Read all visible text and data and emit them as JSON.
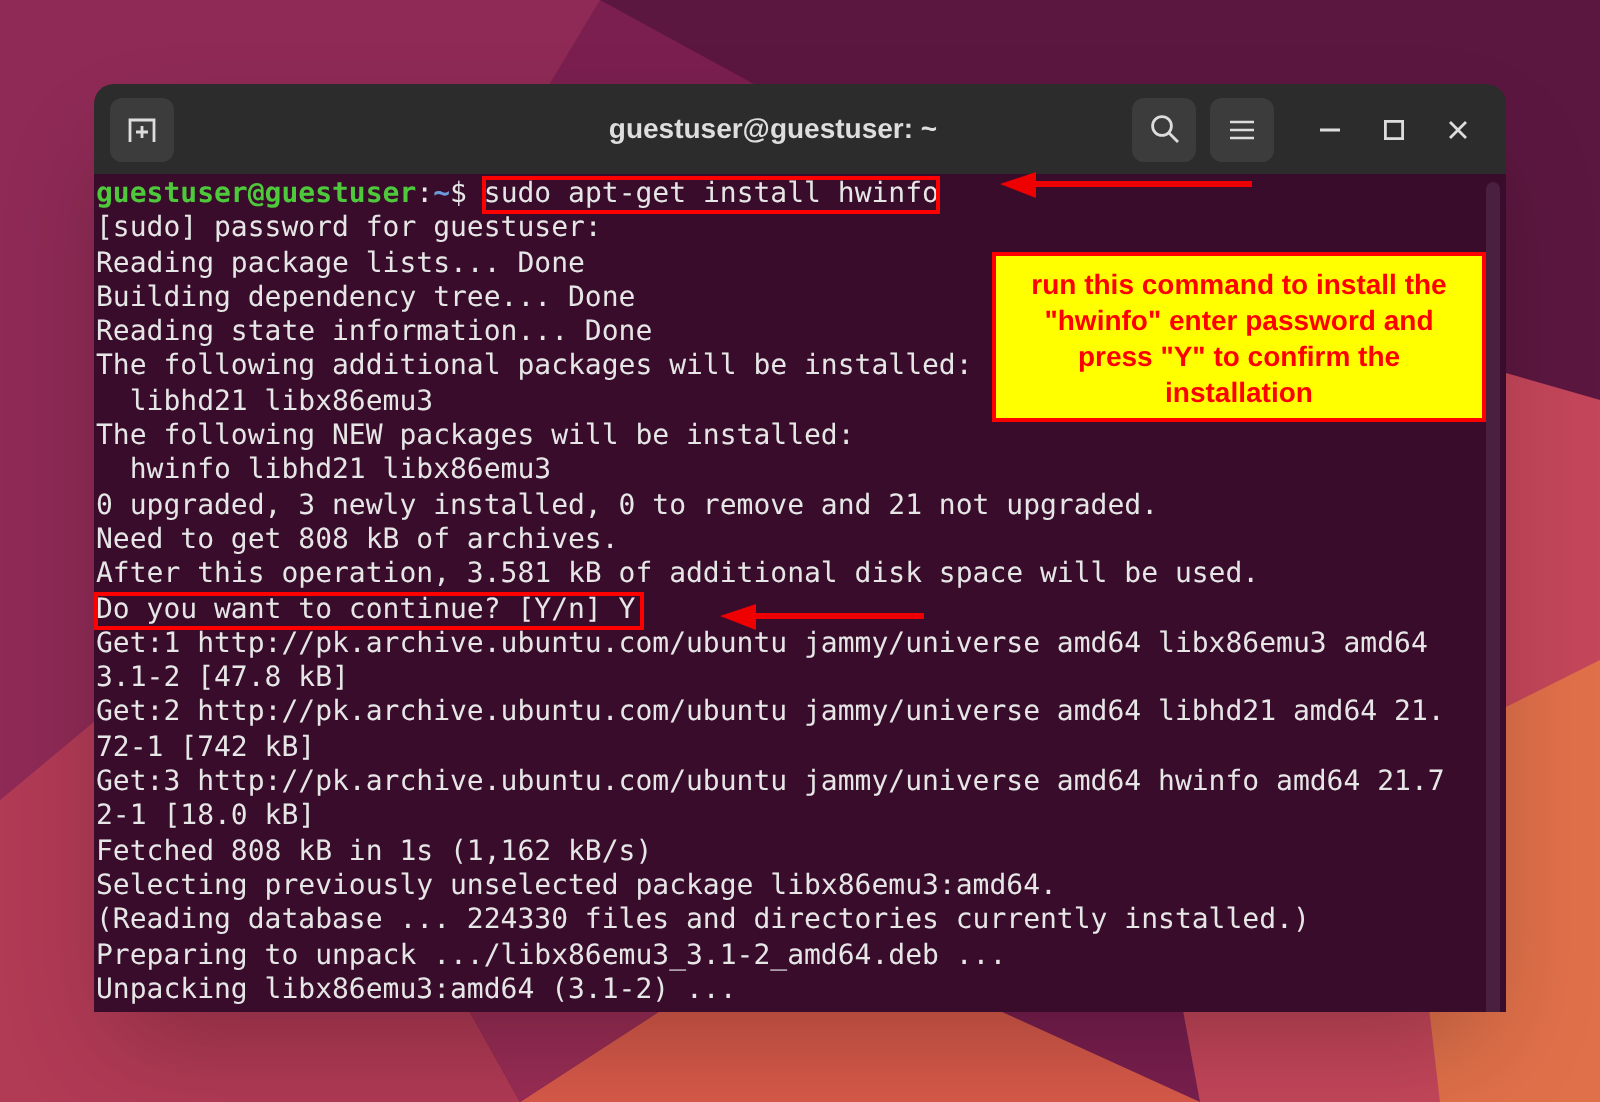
{
  "window": {
    "title": "guestuser@guestuser: ~"
  },
  "terminal": {
    "lines": [
      {
        "kind": "prompt",
        "user": "guestuser@guestuser",
        "separator": ":",
        "path": "~",
        "symbol": "$",
        "command": "sudo apt-get install hwinfo",
        "highlighted": true
      },
      {
        "kind": "output",
        "text": "[sudo] password for guestuser:",
        "highlighted": false
      },
      {
        "kind": "output",
        "text": "Reading package lists... Done",
        "highlighted": false
      },
      {
        "kind": "output",
        "text": "Building dependency tree... Done",
        "highlighted": false
      },
      {
        "kind": "output",
        "text": "Reading state information... Done",
        "highlighted": false
      },
      {
        "kind": "output",
        "text": "The following additional packages will be installed:",
        "highlighted": false
      },
      {
        "kind": "output",
        "text": "  libhd21 libx86emu3",
        "highlighted": false
      },
      {
        "kind": "output",
        "text": "The following NEW packages will be installed:",
        "highlighted": false
      },
      {
        "kind": "output",
        "text": "  hwinfo libhd21 libx86emu3",
        "highlighted": false
      },
      {
        "kind": "output",
        "text": "0 upgraded, 3 newly installed, 0 to remove and 21 not upgraded.",
        "highlighted": false
      },
      {
        "kind": "output",
        "text": "Need to get 808 kB of archives.",
        "highlighted": false
      },
      {
        "kind": "output",
        "text": "After this operation, 3.581 kB of additional disk space will be used.",
        "highlighted": false
      },
      {
        "kind": "output",
        "text": "Do you want to continue? [Y/n] Y",
        "highlighted": true
      },
      {
        "kind": "output",
        "text": "Get:1 http://pk.archive.ubuntu.com/ubuntu jammy/universe amd64 libx86emu3 amd64",
        "highlighted": false
      },
      {
        "kind": "output",
        "text": "3.1-2 [47.8 kB]",
        "highlighted": false
      },
      {
        "kind": "output",
        "text": "Get:2 http://pk.archive.ubuntu.com/ubuntu jammy/universe amd64 libhd21 amd64 21.",
        "highlighted": false
      },
      {
        "kind": "output",
        "text": "72-1 [742 kB]",
        "highlighted": false
      },
      {
        "kind": "output",
        "text": "Get:3 http://pk.archive.ubuntu.com/ubuntu jammy/universe amd64 hwinfo amd64 21.7",
        "highlighted": false
      },
      {
        "kind": "output",
        "text": "2-1 [18.0 kB]",
        "highlighted": false
      },
      {
        "kind": "output",
        "text": "Fetched 808 kB in 1s (1,162 kB/s)",
        "highlighted": false
      },
      {
        "kind": "output",
        "text": "Selecting previously unselected package libx86emu3:amd64.",
        "highlighted": false
      },
      {
        "kind": "output",
        "text": "(Reading database ... 224330 files and directories currently installed.)",
        "highlighted": false
      },
      {
        "kind": "output",
        "text": "Preparing to unpack .../libx86emu3_3.1-2_amd64.deb ...",
        "highlighted": false
      },
      {
        "kind": "output",
        "text": "Unpacking libx86emu3:amd64 (3.1-2) ...",
        "highlighted": false
      }
    ]
  },
  "callout": {
    "text": "run this command to install the \"hwinfo\" enter password and press \"Y\" to confirm the installation"
  }
}
